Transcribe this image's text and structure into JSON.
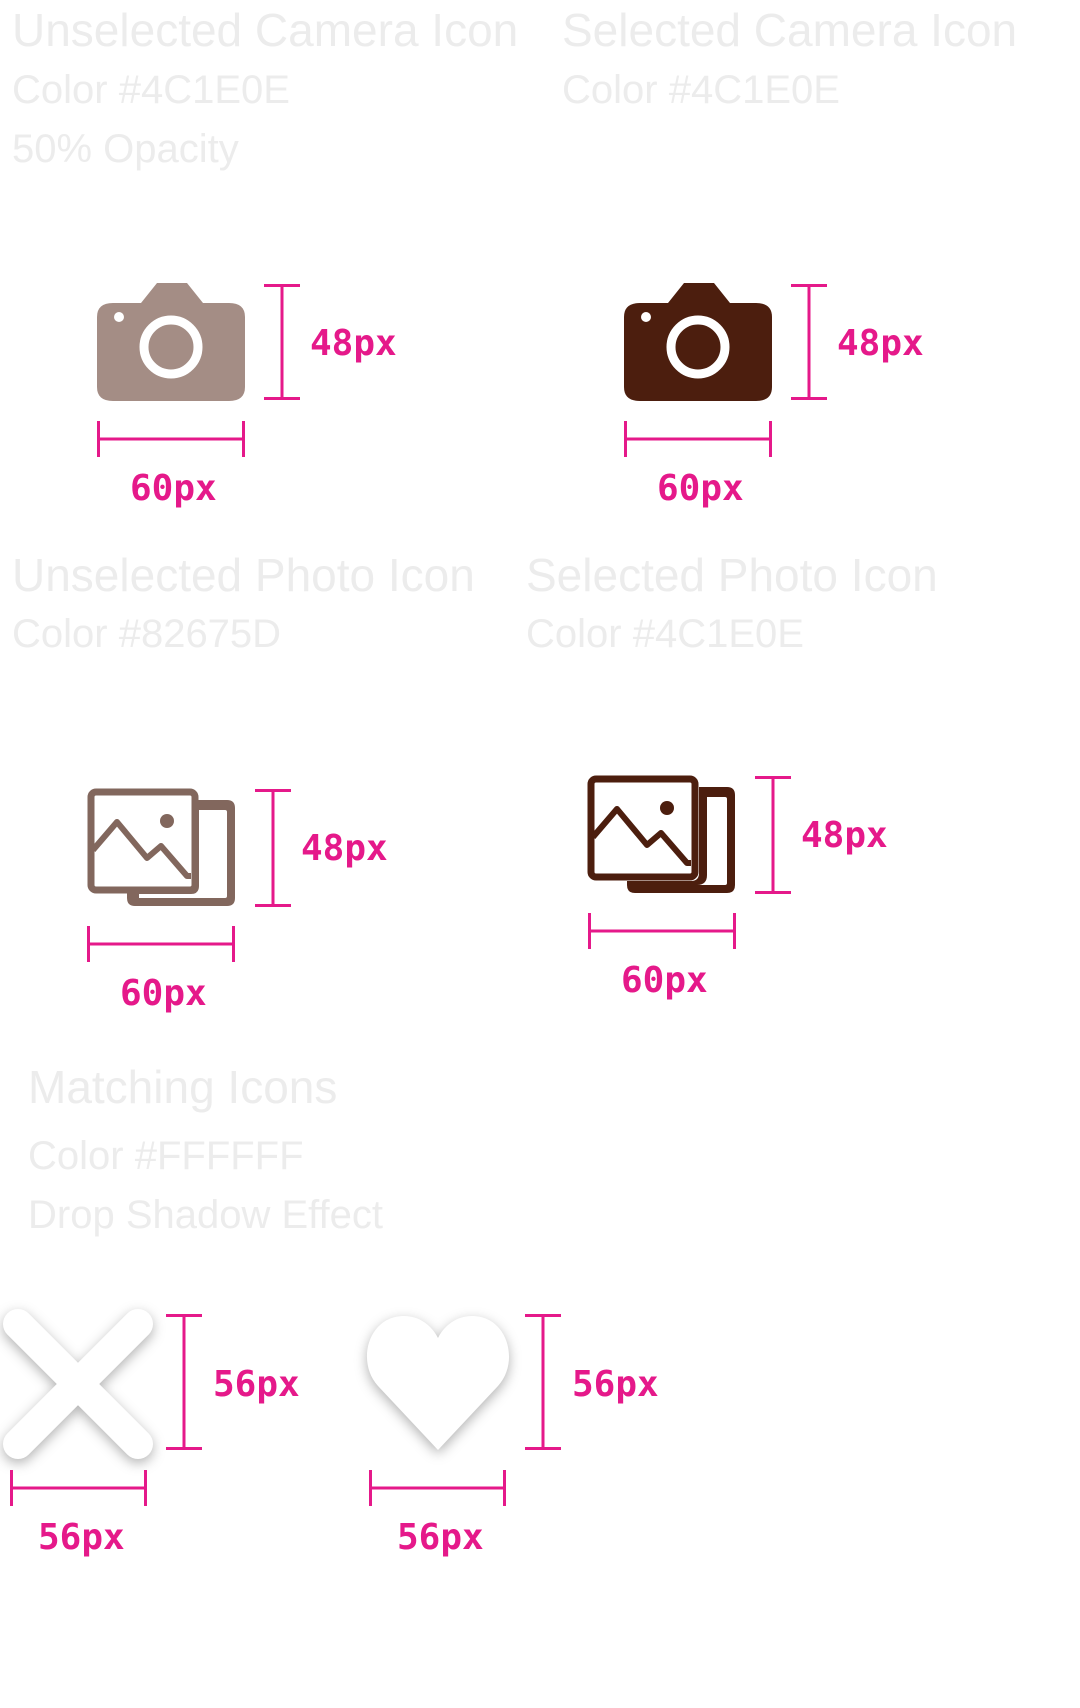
{
  "sections": {
    "camera_unselected": {
      "title": "Unselected Camera Icon",
      "color_label": "Color #4C1E0E",
      "opacity_label": "50% Opacity",
      "height_label": "48px",
      "width_label": "60px",
      "icon": "camera-icon",
      "color": "#4C1E0E",
      "opacity": 0.5
    },
    "camera_selected": {
      "title": "Selected Camera Icon",
      "color_label": "Color #4C1E0E",
      "height_label": "48px",
      "width_label": "60px",
      "icon": "camera-icon",
      "color": "#4C1E0E"
    },
    "photo_unselected": {
      "title": "Unselected Photo Icon",
      "color_label": "Color #82675D",
      "height_label": "48px",
      "width_label": "60px",
      "icon": "photo-icon",
      "color": "#82675D"
    },
    "photo_selected": {
      "title": "Selected Photo Icon",
      "color_label": "Color #4C1E0E",
      "height_label": "48px",
      "width_label": "60px",
      "icon": "photo-icon",
      "color": "#4C1E0E"
    },
    "matching": {
      "title": "Matching Icons",
      "color_label": "Color #FFFFFF",
      "effect_label": "Drop Shadow Effect",
      "color": "#FFFFFF",
      "close": {
        "icon": "close-icon",
        "height_label": "56px",
        "width_label": "56px"
      },
      "heart": {
        "icon": "heart-icon",
        "height_label": "56px",
        "width_label": "56px"
      }
    }
  },
  "colors": {
    "measure": "#E5198A",
    "label": "#ECECEC"
  }
}
